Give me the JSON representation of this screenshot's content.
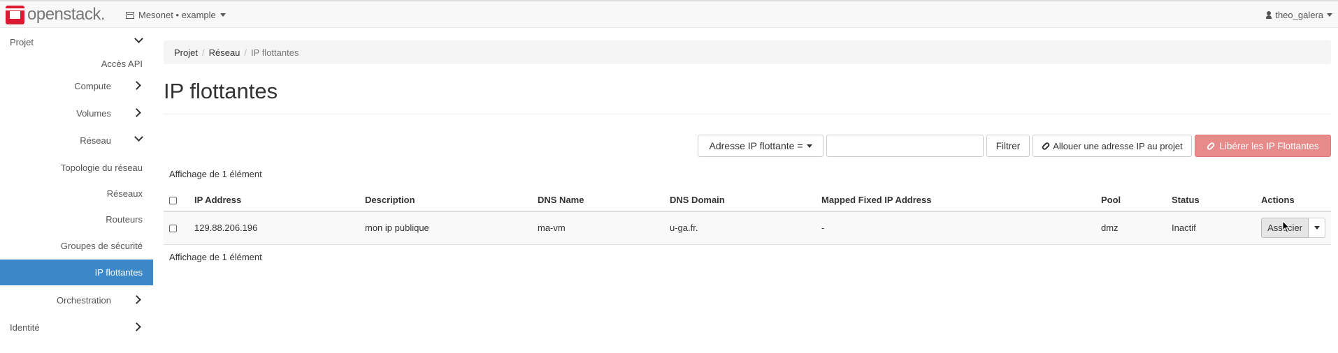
{
  "navbar": {
    "brand": "openstack",
    "brand_suffix": ".",
    "project_selector": "Mesonet • example",
    "user": "theo_galera"
  },
  "sidebar": {
    "projet": "Projet",
    "acces_api": "Accès API",
    "compute": "Compute",
    "volumes": "Volumes",
    "reseau": "Réseau",
    "topologie": "Topologie du réseau",
    "reseaux": "Réseaux",
    "routeurs": "Routeurs",
    "groupes": "Groupes de sécurité",
    "ip_flottantes": "IP flottantes",
    "orchestration": "Orchestration",
    "identite": "Identité"
  },
  "breadcrumb": {
    "projet": "Projet",
    "reseau": "Réseau",
    "current": "IP flottantes",
    "separator": "/"
  },
  "page": {
    "title": "IP flottantes"
  },
  "toolbar": {
    "filter_field": "Adresse IP flottante =",
    "filter_value": "",
    "filter_button": "Filtrer",
    "allocate_button": "Allouer une adresse IP au projet",
    "release_button": "Libérer les IP Flottantes"
  },
  "table": {
    "count_top": "Affichage de 1 élément",
    "count_bottom": "Affichage de 1 élément",
    "headers": [
      "IP Address",
      "Description",
      "DNS Name",
      "DNS Domain",
      "Mapped Fixed IP Address",
      "Pool",
      "Status",
      "Actions"
    ],
    "rows": [
      {
        "ip": "129.88.206.196",
        "description": "mon ip publique",
        "dns_name": "ma-vm",
        "dns_domain": "u-ga.fr.",
        "mapped_ip": "-",
        "pool": "dmz",
        "status": "Inactif",
        "action": "Associer"
      }
    ]
  },
  "colors": {
    "active_sidebar": "#3b87c7",
    "release_button": "#e68a8a",
    "brand_red": "#da1a32"
  }
}
